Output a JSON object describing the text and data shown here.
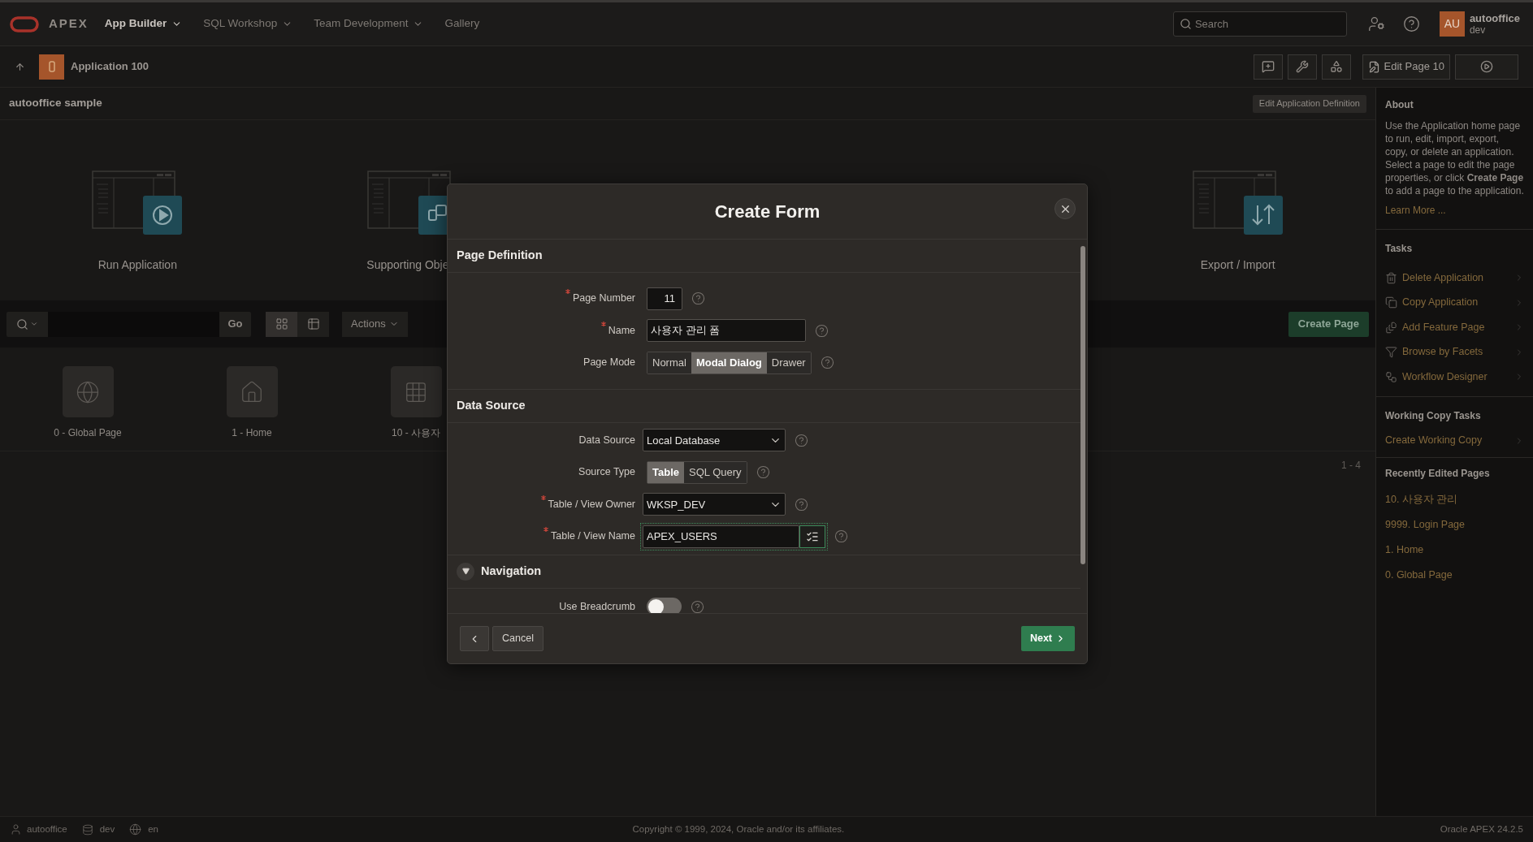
{
  "header": {
    "logo": "APEX",
    "nav": [
      {
        "label": "App Builder",
        "selected": true
      },
      {
        "label": "SQL Workshop",
        "selected": false
      },
      {
        "label": "Team Development",
        "selected": false
      },
      {
        "label": "Gallery",
        "selected": false,
        "menu": false
      }
    ],
    "search": {
      "placeholder": "Search"
    },
    "user": {
      "initials": "AU",
      "name": "autooffice",
      "workspace": "dev"
    }
  },
  "app_bar": {
    "title": "Application 100",
    "edit_button": "Edit Page 10"
  },
  "app_title": "autooffice sample",
  "edit_definition": "Edit Application Definition",
  "cards": [
    {
      "label": "Run Application",
      "kind": "run"
    },
    {
      "label": "Supporting Obje",
      "kind": "objects"
    },
    {
      "label": "Export / Import",
      "kind": "transfer"
    }
  ],
  "toolbar": {
    "go": "Go",
    "views": [
      {
        "kind": "grid",
        "selected": true
      },
      {
        "kind": "table",
        "selected": false
      }
    ],
    "actions": "Actions",
    "create_page": "Create Page"
  },
  "pages": [
    {
      "label": "0 - Global Page",
      "kind": "globe"
    },
    {
      "label": "1 - Home",
      "kind": "home"
    },
    {
      "label": "10 - 사용자",
      "kind": "grid"
    }
  ],
  "pagination": "1 - 4",
  "sidebar": {
    "about_title": "About",
    "about_text": "Use the Application home page to run, edit, import, export, copy, or delete an application. Select a page to edit the page properties, or click **Create Page** to add a page to the application.",
    "learn_more": "Learn More ...",
    "tasks_title": "Tasks",
    "tasks": [
      {
        "label": "Delete Application",
        "kind": "trash"
      },
      {
        "label": "Copy Application",
        "kind": "copy"
      },
      {
        "label": "Add Feature Page",
        "kind": "page"
      },
      {
        "label": "Browse by Facets",
        "kind": "filter"
      },
      {
        "label": "Workflow Designer",
        "kind": "workflow"
      }
    ],
    "working_title": "Working Copy Tasks",
    "working_tasks": [
      {
        "label": "Create Working Copy"
      }
    ],
    "recent_title": "Recently Edited Pages",
    "recent": [
      "10. 사용자 관리",
      "9999. Login Page",
      "1. Home",
      "0. Global Page"
    ]
  },
  "dialog": {
    "title": "Create Form",
    "sections": [
      {
        "title": "Page Definition",
        "fields": [
          {
            "label": "Page Number",
            "required": true,
            "kind": "number",
            "value": "11"
          },
          {
            "label": "Name",
            "required": true,
            "kind": "text",
            "value": "사용자 관리 폼"
          },
          {
            "label": "Page Mode",
            "required": false,
            "kind": "segmented",
            "options": [
              {
                "label": "Normal",
                "selected": false
              },
              {
                "label": "Modal Dialog",
                "selected": true
              },
              {
                "label": "Drawer",
                "selected": false
              }
            ]
          }
        ]
      },
      {
        "title": "Data Source",
        "fields": [
          {
            "label": "Data Source",
            "required": false,
            "kind": "select",
            "value": "Local Database"
          },
          {
            "label": "Source Type",
            "required": false,
            "kind": "segmented",
            "options": [
              {
                "label": "Table",
                "selected": true
              },
              {
                "label": "SQL Query",
                "selected": false
              }
            ]
          },
          {
            "label": "Table / View Owner",
            "required": true,
            "kind": "select",
            "value": "WKSP_DEV"
          },
          {
            "label": "Table / View Name",
            "required": true,
            "kind": "popup",
            "value": "APEX_USERS",
            "focused": true
          }
        ]
      },
      {
        "title": "Navigation",
        "expanded": true,
        "fields": [
          {
            "label": "Use Breadcrumb",
            "required": false,
            "kind": "toggle",
            "on": false
          }
        ]
      }
    ],
    "cancel": "Cancel",
    "next": "Next"
  },
  "footer": {
    "user": "autooffice",
    "workspace": "dev",
    "language": "en",
    "copyright": "Copyright © 1999, 2024, Oracle and/or its affiliates.",
    "version": "Oracle APEX 24.2.5"
  }
}
